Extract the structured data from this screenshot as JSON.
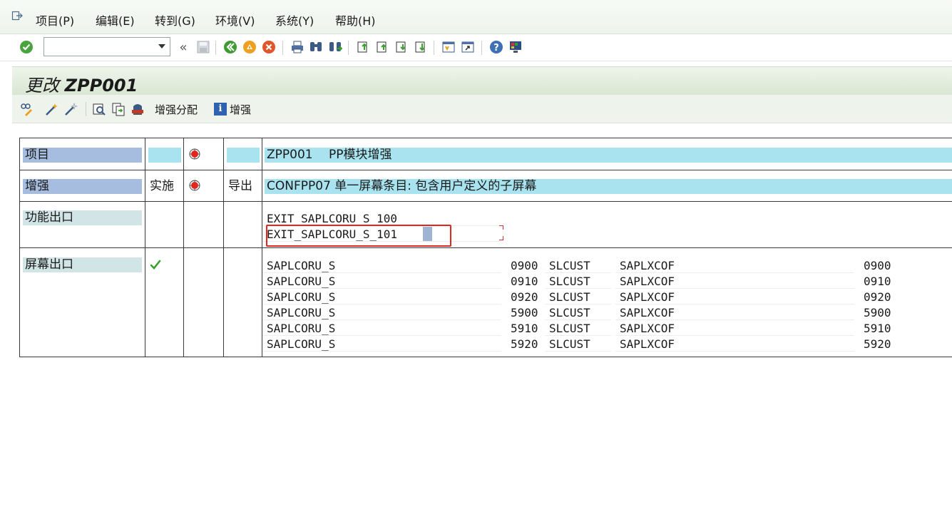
{
  "menu": {
    "items": [
      "项目(P)",
      "编辑(E)",
      "转到(G)",
      "环境(V)",
      "系统(Y)",
      "帮助(H)"
    ]
  },
  "toolbar": {
    "command_value": "",
    "back_label": "«"
  },
  "title": {
    "prefix": "更改",
    "object": "ZPP001"
  },
  "app_toolbar": {
    "assign_label": "增强分配",
    "enhance_label": "增强"
  },
  "rows": {
    "project": {
      "label": "项目",
      "value": "ZPP001　 PP模块增强"
    },
    "enhancement": {
      "label": "增强",
      "impl": "实施",
      "export": "导出",
      "value": "CONFPP07 单一屏幕条目: 包含用户定义的子屏幕"
    },
    "function_exit": {
      "label": "功能出口",
      "items": [
        "EXIT_SAPLCORU_S_100",
        "EXIT_SAPLCORU_S_101"
      ]
    },
    "screen_exit": {
      "label": "屏幕出口",
      "items": [
        {
          "program": "SAPLCORU_S",
          "screen": "0900",
          "area": "SLCUST",
          "called_program": "SAPLXCOF",
          "called_screen": "0900"
        },
        {
          "program": "SAPLCORU_S",
          "screen": "0910",
          "area": "SLCUST",
          "called_program": "SAPLXCOF",
          "called_screen": "0910"
        },
        {
          "program": "SAPLCORU_S",
          "screen": "0920",
          "area": "SLCUST",
          "called_program": "SAPLXCOF",
          "called_screen": "0920"
        },
        {
          "program": "SAPLCORU_S",
          "screen": "5900",
          "area": "SLCUST",
          "called_program": "SAPLXCOF",
          "called_screen": "5900"
        },
        {
          "program": "SAPLCORU_S",
          "screen": "5910",
          "area": "SLCUST",
          "called_program": "SAPLXCOF",
          "called_screen": "5910"
        },
        {
          "program": "SAPLCORU_S",
          "screen": "5920",
          "area": "SLCUST",
          "called_program": "SAPLXCOF",
          "called_screen": "5920"
        }
      ]
    }
  },
  "colors": {
    "label_blue": "#a7bde0",
    "value_cyan": "#a8e3ef",
    "highlight_red": "#e0261f",
    "status_inactive_red": "#e0261f",
    "active_green": "#3aa02e"
  }
}
